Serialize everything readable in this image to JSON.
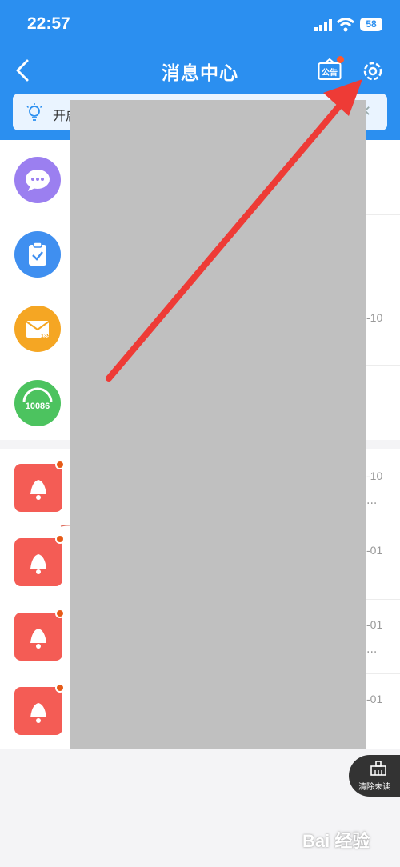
{
  "status": {
    "time": "22:57",
    "battery": "58"
  },
  "header": {
    "title": "消息中心",
    "notice_label": "公告"
  },
  "banner": {
    "text": "开启"
  },
  "list1": {
    "items": [
      {
        "icon": "chat-bubble-icon",
        "color": "#9b7ff0",
        "date": ""
      },
      {
        "icon": "clipboard-check-icon",
        "color": "#3f8ff0",
        "date": ""
      },
      {
        "icon": "mail-139-icon",
        "color": "#f5a623",
        "date": "-10",
        "icon_text": "139"
      },
      {
        "icon": "service-10086-icon",
        "color": "#4cc35f",
        "date": "",
        "icon_text": "10086"
      }
    ]
  },
  "list2": {
    "items": [
      {
        "icon": "bell-icon",
        "date": "-10",
        "has_dots": true
      },
      {
        "icon": "bell-icon",
        "date": "-01",
        "has_dots": false
      },
      {
        "icon": "bell-icon",
        "date": "-01",
        "has_dots": true
      },
      {
        "icon": "bell-icon",
        "date": "-01",
        "has_dots": false
      }
    ]
  },
  "clear_button": {
    "label": "清除未读"
  },
  "watermark": {
    "text": "Bai 经验"
  },
  "colors": {
    "header": "#2b8ff0",
    "arrow": "#ee3b36",
    "bell": "#f45c55",
    "dot": "#e65a17"
  }
}
